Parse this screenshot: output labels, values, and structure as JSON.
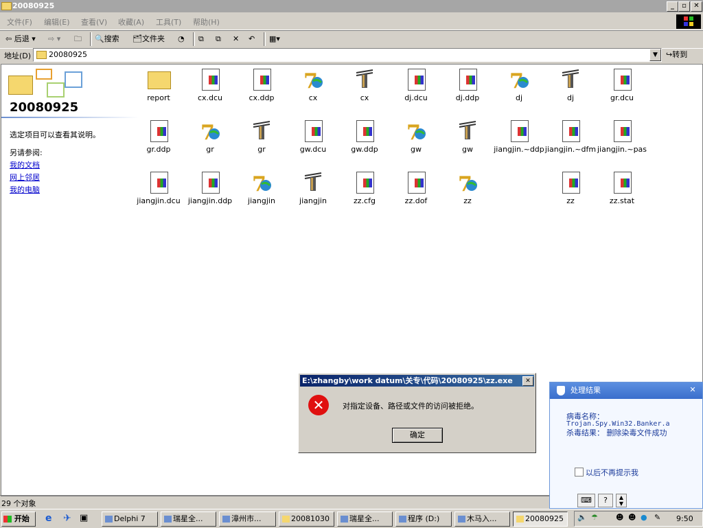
{
  "window": {
    "title": "20080925"
  },
  "menu": [
    "文件(F)",
    "编辑(E)",
    "查看(V)",
    "收藏(A)",
    "工具(T)",
    "帮助(H)"
  ],
  "toolbar": {
    "back": "后退",
    "search": "搜索",
    "folders": "文件夹"
  },
  "address": {
    "label": "地址(D)",
    "value": "20080925",
    "go": "转到"
  },
  "sidebar": {
    "title": "20080925",
    "desc": "选定项目可以查看其说明。",
    "see_also": "另请参阅:",
    "links": [
      "我的文档",
      "网上邻居",
      "我的电脑"
    ]
  },
  "files": [
    {
      "name": "report",
      "icon": "folder-icon"
    },
    {
      "name": "cx.dcu",
      "icon": "document-icon"
    },
    {
      "name": "cx.ddp",
      "icon": "document-icon"
    },
    {
      "name": "cx",
      "icon": "delphi-project-icon"
    },
    {
      "name": "cx",
      "icon": "unit-icon"
    },
    {
      "name": "dj.dcu",
      "icon": "document-icon"
    },
    {
      "name": "dj.ddp",
      "icon": "document-icon"
    },
    {
      "name": "dj",
      "icon": "delphi-project-icon"
    },
    {
      "name": "dj",
      "icon": "unit-icon"
    },
    {
      "name": "gr.dcu",
      "icon": "document-icon"
    },
    {
      "name": "gr.ddp",
      "icon": "document-icon"
    },
    {
      "name": "gr",
      "icon": "delphi-project-icon"
    },
    {
      "name": "gr",
      "icon": "unit-icon"
    },
    {
      "name": "gw.dcu",
      "icon": "document-icon"
    },
    {
      "name": "gw.ddp",
      "icon": "document-icon"
    },
    {
      "name": "gw",
      "icon": "delphi-project-icon"
    },
    {
      "name": "gw",
      "icon": "unit-icon"
    },
    {
      "name": "jiangjin.~ddp",
      "icon": "document-icon"
    },
    {
      "name": "jiangjin.~dfm",
      "icon": "document-icon"
    },
    {
      "name": "jiangjin.~pas",
      "icon": "document-icon"
    },
    {
      "name": "jiangjin.dcu",
      "icon": "document-icon"
    },
    {
      "name": "jiangjin.ddp",
      "icon": "document-icon"
    },
    {
      "name": "jiangjin",
      "icon": "delphi-project-icon"
    },
    {
      "name": "jiangjin",
      "icon": "unit-icon"
    },
    {
      "name": "zz.cfg",
      "icon": "document-icon"
    },
    {
      "name": "zz.dof",
      "icon": "document-icon"
    },
    {
      "name": "zz",
      "icon": "delphi-project-icon"
    },
    {
      "name": "zz",
      "icon": "document-icon"
    },
    {
      "name": "zz.stat",
      "icon": "document-icon"
    }
  ],
  "status": "29 个对象",
  "dialog": {
    "title": "E:\\zhangby\\work datum\\关专\\代码\\20080925\\zz.exe",
    "message": "对指定设备、路径或文件的访问被拒绝。",
    "ok": "确定"
  },
  "popup": {
    "title": "处理结果",
    "virus_label": "病毒名称：",
    "virus_name": "Trojan.Spy.Win32.Banker.a",
    "result": "杀毒结果：  删除染毒文件成功",
    "checkbox": "以后不再提示我"
  },
  "taskbar": {
    "start": "开始",
    "tasks": [
      "Delphi 7",
      "瑞星全...",
      "漳州市...",
      "20081030",
      "瑞星全...",
      "程序 (D:)",
      "木马入...",
      "20080925"
    ],
    "time": "9:50"
  }
}
